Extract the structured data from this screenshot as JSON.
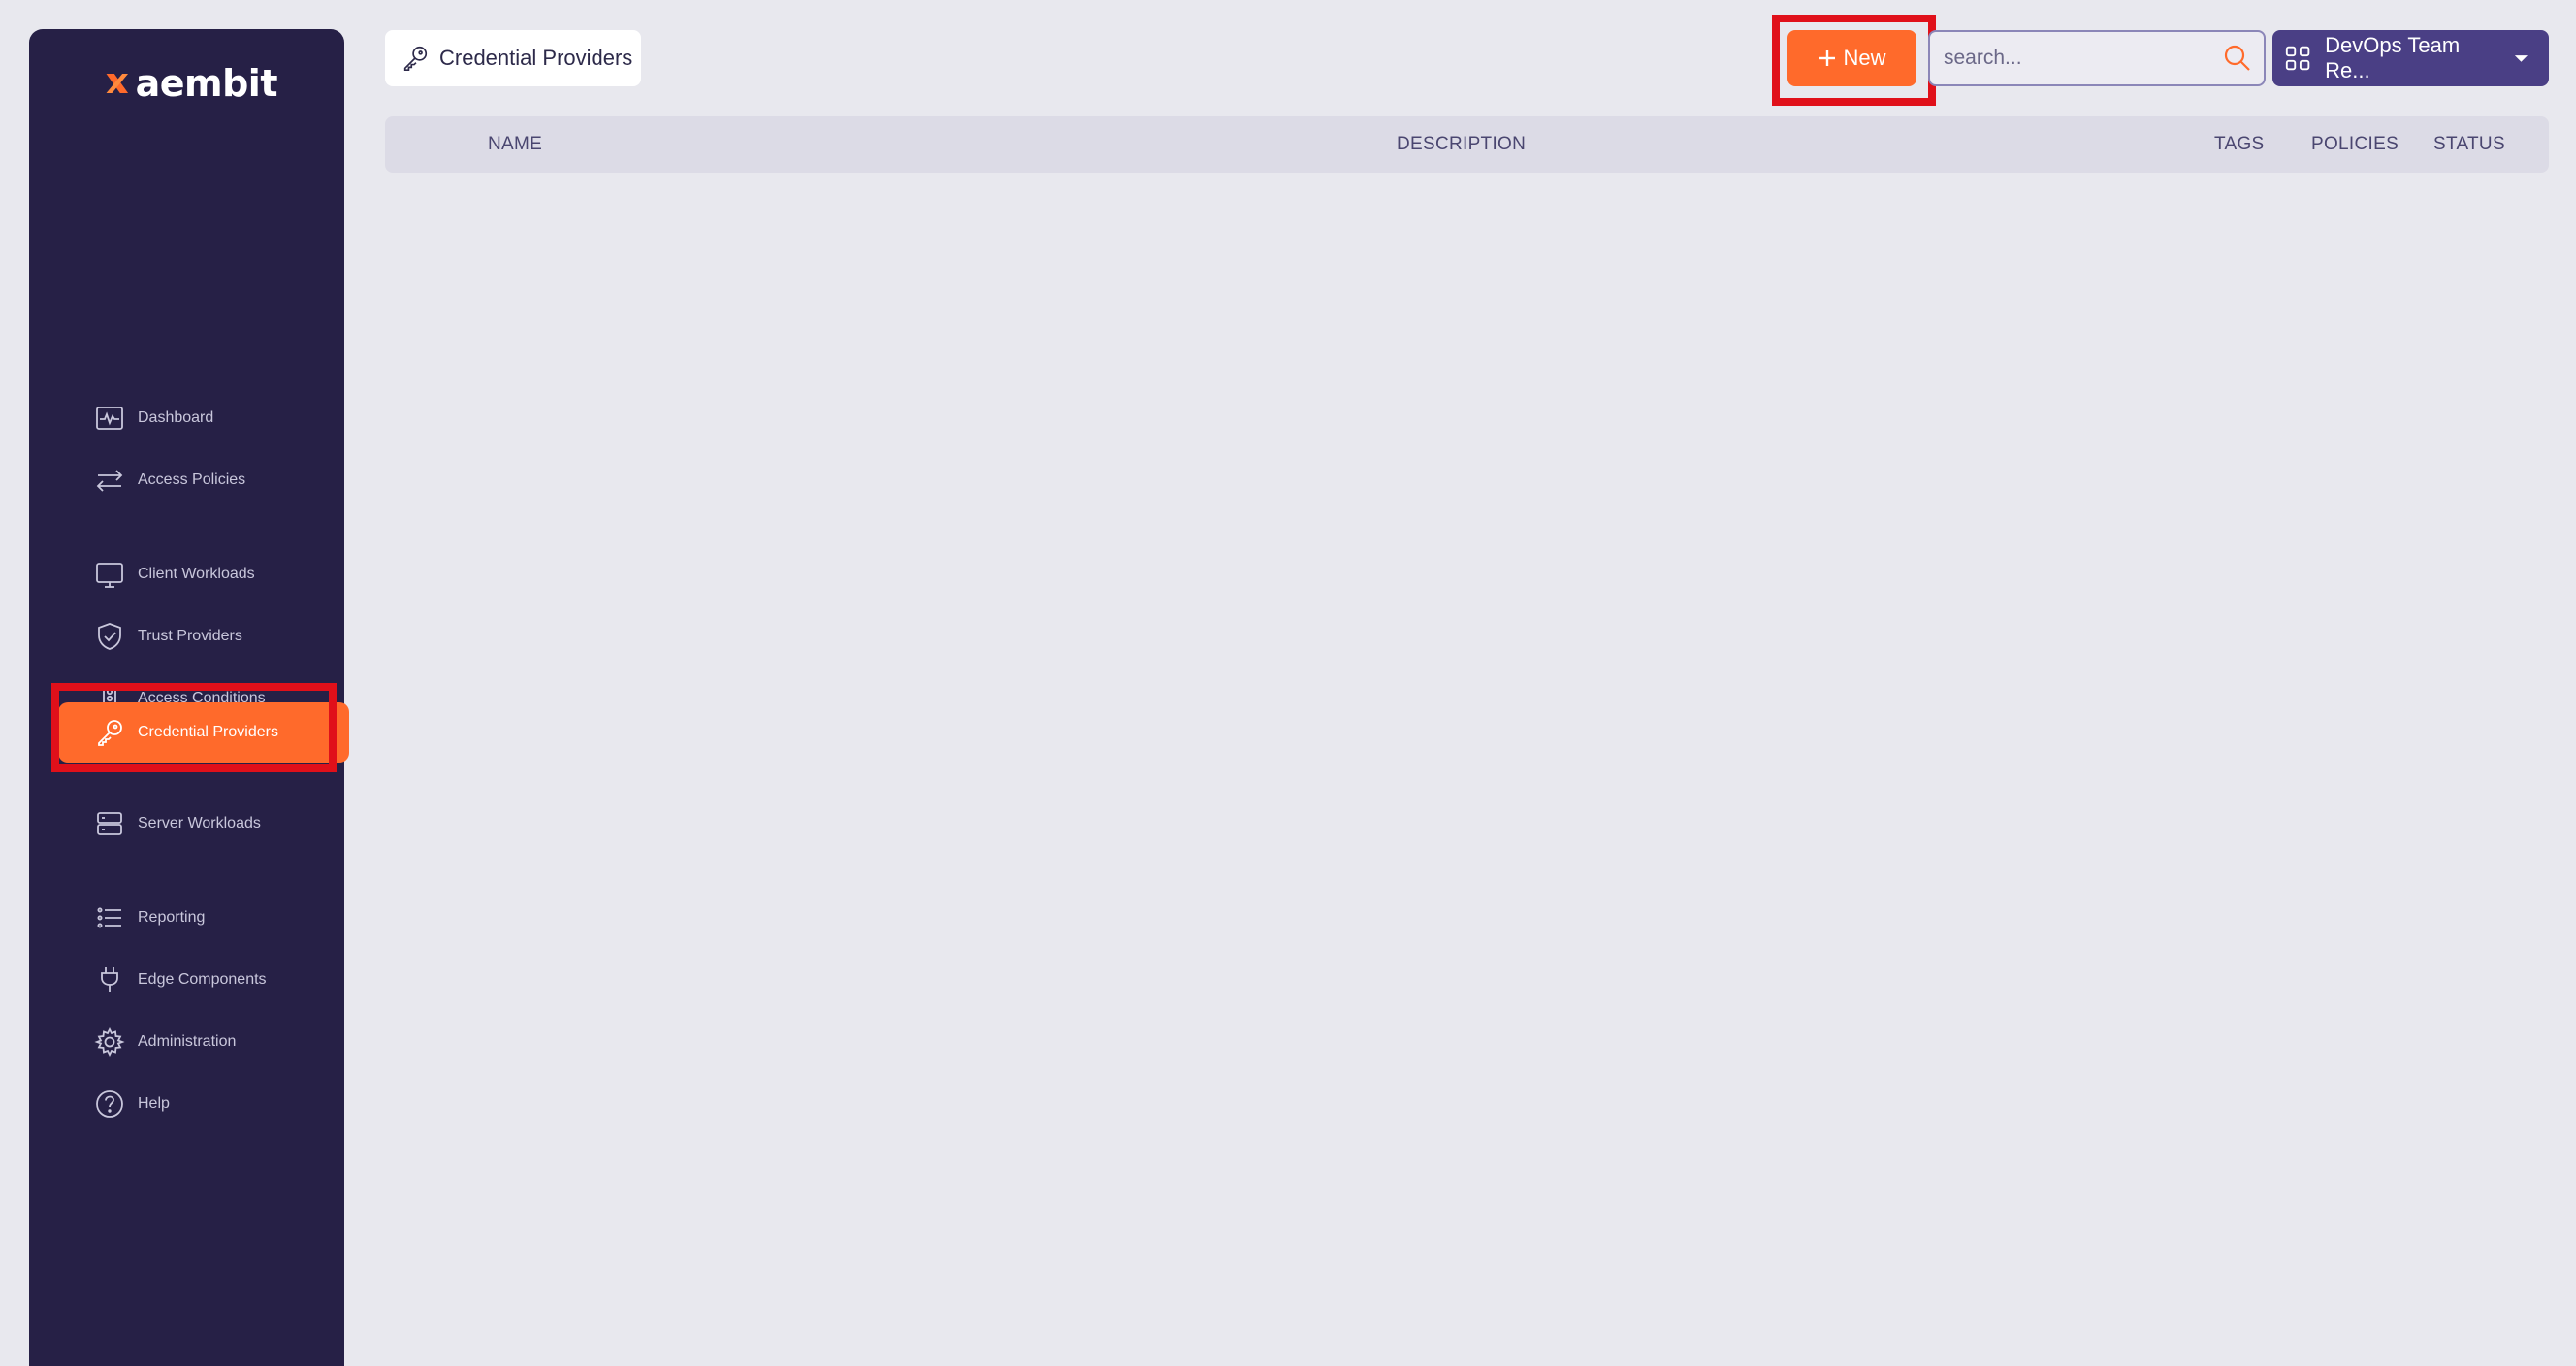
{
  "app": {
    "logo_text": "aembit"
  },
  "sidebar": {
    "items": [
      {
        "label": "Dashboard",
        "icon": "activity-icon"
      },
      {
        "label": "Access Policies",
        "icon": "arrows-exchange-icon"
      },
      {
        "label": "Client Workloads",
        "icon": "monitor-icon"
      },
      {
        "label": "Trust Providers",
        "icon": "shield-check-icon"
      },
      {
        "label": "Access Conditions",
        "icon": "traffic-light-icon"
      },
      {
        "label": "Credential Providers",
        "icon": "key-icon",
        "active": true
      },
      {
        "label": "Server Workloads",
        "icon": "server-icon"
      },
      {
        "label": "Reporting",
        "icon": "list-icon"
      },
      {
        "label": "Edge Components",
        "icon": "plug-icon"
      },
      {
        "label": "Administration",
        "icon": "gear-icon"
      },
      {
        "label": "Help",
        "icon": "help-circle-icon"
      }
    ]
  },
  "header": {
    "page_title": "Credential Providers",
    "new_button_label": "New",
    "search_placeholder": "search...",
    "org_selector_label": "DevOps Team Re..."
  },
  "table": {
    "columns": [
      "NAME",
      "DESCRIPTION",
      "TAGS",
      "POLICIES",
      "STATUS"
    ]
  },
  "colors": {
    "accent": "#ff6a2b",
    "sidebar_bg": "#262046",
    "highlight": "#e0101a",
    "org_selector_bg": "#4a3f85"
  }
}
